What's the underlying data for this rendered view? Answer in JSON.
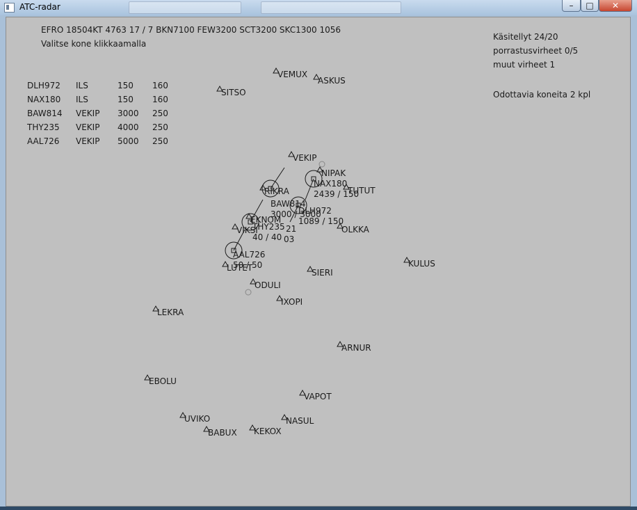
{
  "window": {
    "title": "ATC-radar"
  },
  "header": {
    "weather": "EFRO 18504KT 4763 17 / 7 BKN7100 FEW3200 SCT3200 SKC1300  1056",
    "instruction": "Valitse kone klikkaamalla"
  },
  "stats": {
    "handled": "Käsitellyt 24/20",
    "separation_errors": "porrastusvirheet 0/5",
    "other_errors": "muut virheet 1",
    "waiting": "Odottavia koneita 2 kpl"
  },
  "flight_list": [
    {
      "callsign": "DLH972",
      "route": "ILS",
      "alt": "150",
      "speed": "160"
    },
    {
      "callsign": "NAX180",
      "route": "ILS",
      "alt": "150",
      "speed": "160"
    },
    {
      "callsign": "BAW814",
      "route": "VEKIP",
      "alt": "3000",
      "speed": "250"
    },
    {
      "callsign": "THY235",
      "route": "VEKIP",
      "alt": "4000",
      "speed": "250"
    },
    {
      "callsign": "AAL726",
      "route": "VEKIP",
      "alt": "5000",
      "speed": "250"
    }
  ],
  "waypoints": [
    "VEMUX",
    "ASKUS",
    "SITSO",
    "VEKIP",
    "NIPAK",
    "TUTUT",
    "OLKKA",
    "KULUS",
    "SIERI",
    "LUTET",
    "ODULI",
    "IXOPI",
    "LEKRA",
    "ARNUR",
    "EBOLU",
    "VAPOT",
    "UVIKO",
    "NASUL",
    "BABUX",
    "KEKOX",
    "RIKRA",
    "EKNOM",
    "VIKSI"
  ],
  "aircraft": [
    {
      "callsign": "NAX180",
      "data": "2439 / 150"
    },
    {
      "callsign": "BAW814",
      "data": "3000 / 3000"
    },
    {
      "callsign": "DLH972",
      "data": "1089 / 150"
    },
    {
      "callsign": "THY235",
      "data": "40 / 40",
      "extra1": "21",
      "extra2": "03"
    },
    {
      "callsign": "AAL726",
      "data": "50 / 50"
    }
  ],
  "colors": {
    "canvas": "#c0c0c0",
    "ink": "#1a1a1a"
  }
}
